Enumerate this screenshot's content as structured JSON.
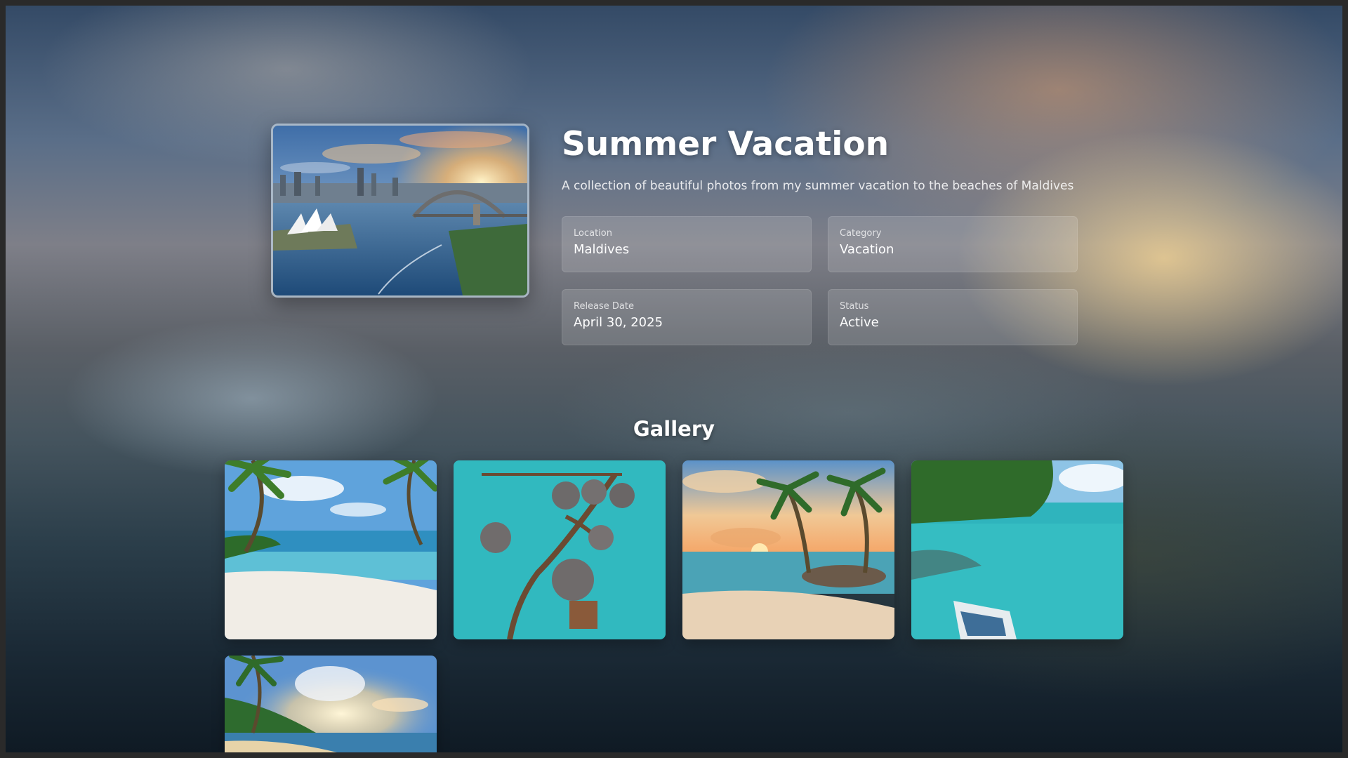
{
  "album": {
    "title": "Summer Vacation",
    "description": "A collection of beautiful photos from my summer vacation to the beaches of Maldives",
    "cover_image": "sydney-harbour-photo"
  },
  "details": {
    "location": {
      "label": "Location",
      "value": "Maldives"
    },
    "category": {
      "label": "Category",
      "value": "Vacation"
    },
    "release_date": {
      "label": "Release Date",
      "value": "April 30, 2025"
    },
    "status": {
      "label": "Status",
      "value": "Active"
    }
  },
  "gallery": {
    "title": "Gallery",
    "photos": [
      "palm-beach-photo",
      "overwater-villas-photo",
      "sunset-palms-photo",
      "lagoon-boat-photo",
      "tropical-sunset-beach-photo"
    ]
  }
}
